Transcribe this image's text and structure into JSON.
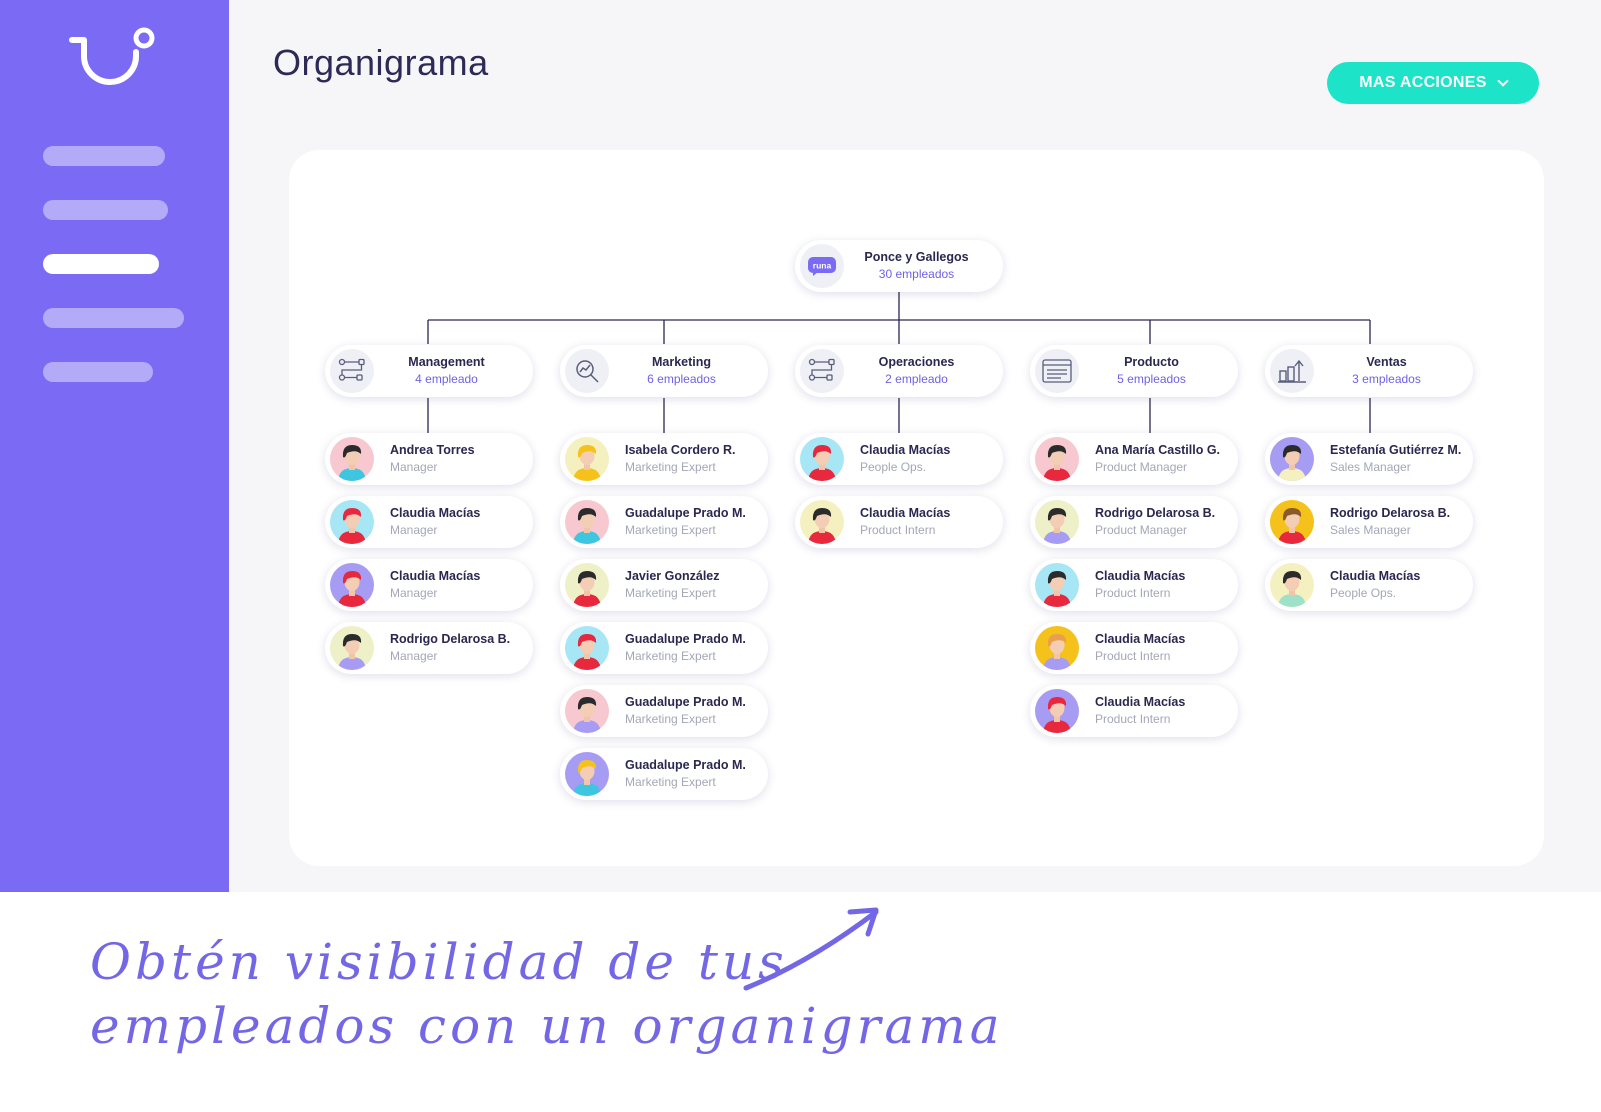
{
  "page": {
    "title": "Organigrama",
    "more_actions_label": "MAS ACCIONES",
    "caption_line1": "Obtén visibilidad de tus",
    "caption_line2": "empleados con un organigrama"
  },
  "colors": {
    "sidebar": "#7b6af3",
    "accent": "#1de3c8",
    "title": "#2d2a57",
    "count": "#6e5fe9"
  },
  "sidebar": {
    "items": [
      {
        "name": "nav-item-1",
        "active": false
      },
      {
        "name": "nav-item-2",
        "active": false
      },
      {
        "name": "nav-item-3",
        "active": true
      },
      {
        "name": "nav-item-4",
        "active": false
      },
      {
        "name": "nav-item-5",
        "active": false
      }
    ]
  },
  "root": {
    "name": "Ponce y Gallegos",
    "count": "30 empleados",
    "logo_text": "runa"
  },
  "departments": [
    {
      "name": "Management",
      "count": "4 empleado",
      "icon": "flow-icon",
      "employees": [
        {
          "name": "Andrea Torres",
          "role": "Manager",
          "bg": "#f7c8cf",
          "hair": "#2b2b2b",
          "shirt": "#3ec6e0"
        },
        {
          "name": "Claudia Macías",
          "role": "Manager",
          "bg": "#a7e6f4",
          "hair": "#e8283c",
          "shirt": "#e8283c"
        },
        {
          "name": "Claudia Macías",
          "role": "Manager",
          "bg": "#a79cf4",
          "hair": "#e8283c",
          "shirt": "#e8283c"
        },
        {
          "name": "Rodrigo Delarosa B.",
          "role": "Manager",
          "bg": "#eef0c8",
          "hair": "#2b2b2b",
          "shirt": "#a79cf4"
        }
      ]
    },
    {
      "name": "Marketing",
      "count": "6 empleados",
      "icon": "analytics-icon",
      "employees": [
        {
          "name": "Isabela Cordero R.",
          "role": "Marketing Expert",
          "bg": "#f5f0c0",
          "hair": "#f4c21a",
          "shirt": "#f4c21a"
        },
        {
          "name": "Guadalupe Prado M.",
          "role": "Marketing Expert",
          "bg": "#f7c8cf",
          "hair": "#2b2b2b",
          "shirt": "#3ec6e0"
        },
        {
          "name": "Javier González",
          "role": "Marketing Expert",
          "bg": "#eef0c8",
          "hair": "#2b2b2b",
          "shirt": "#e8283c"
        },
        {
          "name": "Guadalupe Prado M.",
          "role": "Marketing Expert",
          "bg": "#a7e6f4",
          "hair": "#e8283c",
          "shirt": "#e8283c"
        },
        {
          "name": "Guadalupe Prado M.",
          "role": "Marketing Expert",
          "bg": "#f7c8cf",
          "hair": "#2b2b2b",
          "shirt": "#a79cf4"
        },
        {
          "name": "Guadalupe Prado M.",
          "role": "Marketing Expert",
          "bg": "#a79cf4",
          "hair": "#f4c21a",
          "shirt": "#3ec6e0"
        }
      ]
    },
    {
      "name": "Operaciones",
      "count": "2 empleado",
      "icon": "flow-icon",
      "employees": [
        {
          "name": "Claudia Macías",
          "role": "People Ops.",
          "bg": "#a7e6f4",
          "hair": "#e8283c",
          "shirt": "#e8283c"
        },
        {
          "name": "Claudia Macías",
          "role": "Product Intern",
          "bg": "#f5f0c0",
          "hair": "#2b2b2b",
          "shirt": "#e8283c"
        }
      ]
    },
    {
      "name": "Producto",
      "count": "5 empleados",
      "icon": "browser-icon",
      "employees": [
        {
          "name": "Ana María Castillo G.",
          "role": "Product Manager",
          "bg": "#f7c8cf",
          "hair": "#2b2b2b",
          "shirt": "#e8283c"
        },
        {
          "name": "Rodrigo Delarosa B.",
          "role": "Product Manager",
          "bg": "#eef0c8",
          "hair": "#2b2b2b",
          "shirt": "#a79cf4"
        },
        {
          "name": "Claudia Macías",
          "role": "Product Intern",
          "bg": "#a7e6f4",
          "hair": "#2b2b2b",
          "shirt": "#e8283c"
        },
        {
          "name": "Claudia Macías",
          "role": "Product Intern",
          "bg": "#f4c21a",
          "hair": "#e8a050",
          "shirt": "#a79cf4"
        },
        {
          "name": "Claudia Macías",
          "role": "Product Intern",
          "bg": "#a79cf4",
          "hair": "#e8283c",
          "shirt": "#e8283c"
        }
      ]
    },
    {
      "name": "Ventas",
      "count": "3 empleados",
      "icon": "sales-chart-icon",
      "employees": [
        {
          "name": "Estefanía Gutiérrez M.",
          "role": "Sales Manager",
          "bg": "#a79cf4",
          "hair": "#2b2b2b",
          "shirt": "#f5f0c0"
        },
        {
          "name": "Rodrigo Delarosa B.",
          "role": "Sales Manager",
          "bg": "#f4c21a",
          "hair": "#8a5a2b",
          "shirt": "#e8283c"
        },
        {
          "name": "Claudia Macías",
          "role": "People Ops.",
          "bg": "#f5f0c0",
          "hair": "#2b2b2b",
          "shirt": "#9fe0c8"
        }
      ]
    }
  ]
}
